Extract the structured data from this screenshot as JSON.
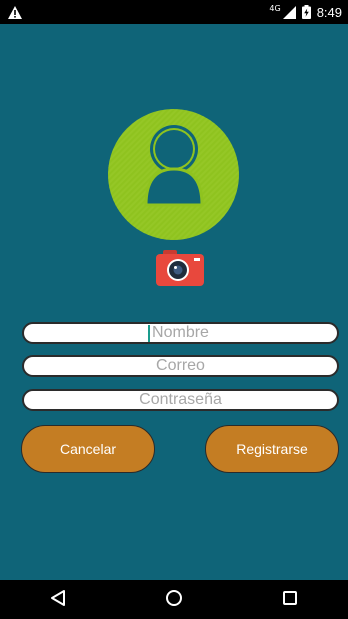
{
  "status_bar": {
    "network": "4G",
    "time": "8:49"
  },
  "form": {
    "name_placeholder": "Nombre",
    "email_placeholder": "Correo",
    "password_placeholder": "Contraseña"
  },
  "buttons": {
    "cancel_label": "Cancelar",
    "register_label": "Registrarse"
  },
  "icons": {
    "alert": "warning-triangle-icon",
    "signal": "cell-signal-icon",
    "battery": "battery-charging-icon",
    "avatar": "user-avatar-icon",
    "camera": "camera-icon",
    "back": "back-triangle-icon",
    "home": "home-circle-icon",
    "recents": "recents-square-icon"
  },
  "colors": {
    "background": "#0f6478",
    "avatar_circle": "#8fc31f",
    "button": "#c47d23",
    "camera": "#e8483d"
  }
}
